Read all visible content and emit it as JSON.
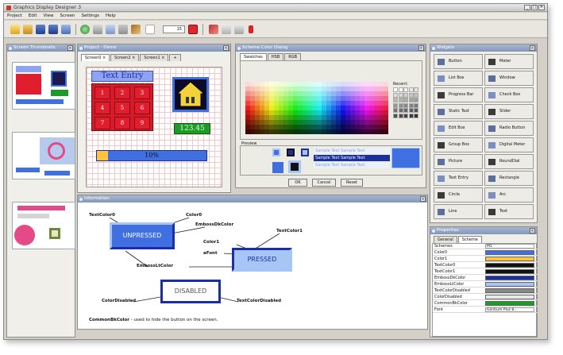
{
  "app": {
    "title": "Graphics Display Designer 3",
    "window_controls": [
      "_",
      "□",
      "✕"
    ],
    "accent_title": "#8497bb"
  },
  "menu": [
    "Project",
    "Edit",
    "View",
    "Screen",
    "Settings",
    "Help"
  ],
  "toolbar": {
    "zoom_value": "15",
    "icons": [
      "new-folder-icon",
      "open-icon",
      "save-icon",
      "save-all-icon",
      "export-icon",
      "screen-add-icon",
      "screen-delete-icon",
      "screen-copy-icon",
      "screen-icon",
      "brush-icon",
      "cursor-tool-icon",
      "cut-icon",
      "copy-icon",
      "paste-icon",
      "delete-icon"
    ]
  },
  "screen_thumbnails": {
    "title": "Screen Thumbnails"
  },
  "project": {
    "title": "Project - Demo",
    "tabs": [
      "Screen0",
      "Screen2",
      "Screen1",
      "+"
    ],
    "text_entry": "Text Entry",
    "keys": [
      "1",
      "2",
      "3",
      "4",
      "5",
      "6",
      "7",
      "8",
      "9"
    ],
    "value": "123.45",
    "progress_text": "10%",
    "progress": 0.1
  },
  "color_dialog": {
    "title": "Scheme Color Dialog",
    "tabs": [
      "Swatches",
      "HSB",
      "RGB"
    ],
    "recent_label": "Recent:",
    "preview_label": "Preview",
    "sample_text": "Sample Text  Sample Text",
    "buttons": [
      "OK",
      "Cancel",
      "Reset"
    ]
  },
  "information": {
    "title": "Information",
    "labels": {
      "text_color0": "TextColor0",
      "color0": "Color0",
      "emboss_dk": "EmbossDkColor",
      "text_color1": "TextColor1",
      "color1": "Color1",
      "font": "aFont",
      "emboss_lt": "EmbossLtColor",
      "color_disabled": "ColorDisabled",
      "text_color_disabled": "TextColorDisabled"
    },
    "button_unpressed": "UNPRESSED",
    "button_pressed": "PRESSED",
    "button_disabled": "DISABLED",
    "footnote_key": "CommonBkColor",
    "footnote_text": " - used to hide the button on the screen."
  },
  "widgets": {
    "title": "Widgets",
    "items": [
      {
        "label": "Button",
        "icon": "button-icon"
      },
      {
        "label": "Meter",
        "icon": "meter-icon"
      },
      {
        "label": "List Box",
        "icon": "listbox-icon"
      },
      {
        "label": "Window",
        "icon": "window-icon"
      },
      {
        "label": "Progress Bar",
        "icon": "progressbar-icon"
      },
      {
        "label": "Check Box",
        "icon": "checkbox-icon"
      },
      {
        "label": "Static Text",
        "icon": "statictext-icon"
      },
      {
        "label": "Slider",
        "icon": "slider-icon"
      },
      {
        "label": "Edit Box",
        "icon": "editbox-icon"
      },
      {
        "label": "Radio Button",
        "icon": "radiobutton-icon"
      },
      {
        "label": "Group Box",
        "icon": "groupbox-icon"
      },
      {
        "label": "Digital Meter",
        "icon": "digitalmeter-icon"
      },
      {
        "label": "Picture",
        "icon": "picture-icon"
      },
      {
        "label": "RoundDial",
        "icon": "rounddial-icon"
      },
      {
        "label": "Text Entry",
        "icon": "textentry-icon"
      },
      {
        "label": "Rectangle",
        "icon": "rectangle-icon"
      },
      {
        "label": "Circle",
        "icon": "circle-icon"
      },
      {
        "label": "Arc",
        "icon": "arc-icon"
      },
      {
        "label": "Line",
        "icon": "line-icon"
      },
      {
        "label": "Text",
        "icon": "text-icon"
      }
    ]
  },
  "properties": {
    "title": "Properties",
    "tabs": [
      "General",
      "Scheme"
    ],
    "rows": [
      {
        "name": "Schemes",
        "value": "M1",
        "color": ""
      },
      {
        "name": "Color0",
        "value": "",
        "color": "#3f6fe0"
      },
      {
        "name": "Color1",
        "value": "",
        "color": "#ffc43d"
      },
      {
        "name": "TextColor0",
        "value": "",
        "color": "#111111"
      },
      {
        "name": "TextColor1",
        "value": "",
        "color": "#111111"
      },
      {
        "name": "EmbossDkColor",
        "value": "",
        "color": "#1a2fa0"
      },
      {
        "name": "EmbossLtColor",
        "value": "",
        "color": "#a8c6f5"
      },
      {
        "name": "TextColorDisabled",
        "value": "",
        "color": "#888888"
      },
      {
        "name": "ColorDisabled",
        "value": "",
        "color": "#e8e8e8"
      },
      {
        "name": "CommonBkColor",
        "value": "",
        "color": "#1d9a28"
      },
      {
        "name": "Font",
        "value": "Gentium Plus 8...",
        "color": ""
      }
    ]
  }
}
